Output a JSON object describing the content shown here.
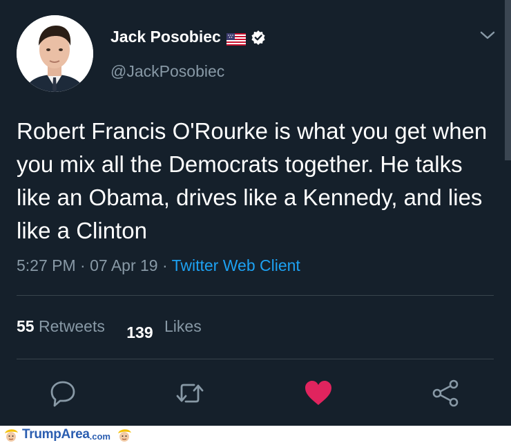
{
  "user": {
    "display_name": "Jack Posobiec",
    "handle": "@JackPosobiec",
    "flag_icon": "us-flag-icon",
    "verified_icon": "verified-badge-icon"
  },
  "tweet": {
    "text": "Robert Francis O'Rourke is what you get when you mix all the Democrats together. He talks like an Obama, drives like a Kennedy, and lies like a Clinton",
    "time": "5:27 PM",
    "separator": " · ",
    "date": "07 Apr 19",
    "client": "Twitter Web Client"
  },
  "stats": {
    "retweets_count": "55",
    "retweets_label": "Retweets",
    "likes_count": "139",
    "likes_label": "Likes"
  },
  "actions": [
    "reply-icon",
    "retweet-icon",
    "heart-icon",
    "share-icon"
  ],
  "footer": {
    "logo_main": "TrumpArea",
    "logo_suffix": ".com"
  },
  "colors": {
    "background": "#15202b",
    "secondary_text": "#8899a6",
    "link": "#1da1f2",
    "like": "#e0245e",
    "divider": "#38444d",
    "logo": "#2a5db0"
  }
}
